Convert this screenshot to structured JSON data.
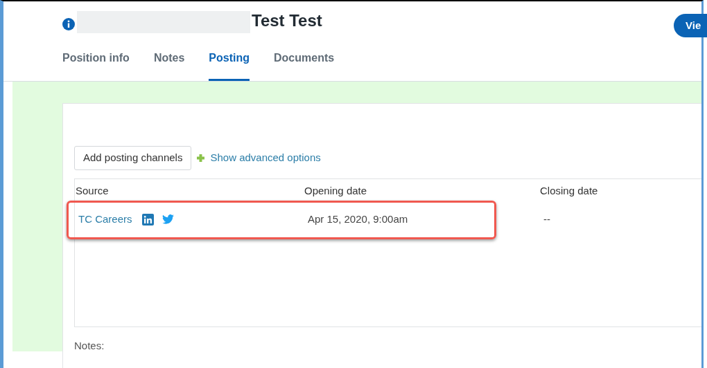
{
  "header": {
    "title": "Test Test",
    "action_button": "Vie"
  },
  "tabs": [
    {
      "label": "Position info",
      "selected": false
    },
    {
      "label": "Notes",
      "selected": false
    },
    {
      "label": "Posting",
      "selected": true
    },
    {
      "label": "Documents",
      "selected": false
    }
  ],
  "toolbar": {
    "add_button": "Add posting channels",
    "advanced_link": "Show advanced options"
  },
  "table": {
    "columns": [
      "Source",
      "Opening date",
      "Closing date"
    ],
    "rows": [
      {
        "source": "TC Careers",
        "highlighted": true,
        "opening_date": "Apr 15, 2020, 9:00am",
        "closing_date": "--"
      }
    ]
  },
  "notes_label": "Notes:"
}
